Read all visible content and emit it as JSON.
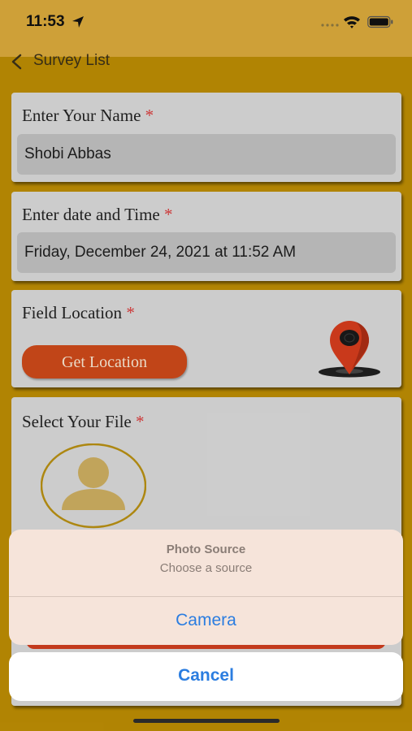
{
  "status_bar": {
    "time": "11:53"
  },
  "nav": {
    "back_label": "Survey List"
  },
  "form": {
    "name": {
      "label": "Enter Your Name",
      "required": "*",
      "value": "Shobi Abbas"
    },
    "datetime": {
      "label": "Enter date and Time",
      "required": "*",
      "value": "Friday, December 24, 2021 at 11:52 AM"
    },
    "location": {
      "label": "Field Location",
      "required": "*",
      "button_label": "Get Location"
    },
    "file": {
      "label": "Select Your File",
      "required": "*"
    }
  },
  "action_sheet": {
    "title": "Photo Source",
    "message": "Choose a source",
    "actions": [
      {
        "label": "Camera"
      }
    ],
    "cancel_label": "Cancel"
  },
  "colors": {
    "background": "#b98a04",
    "status_bar": "#d7a73b",
    "card": "#d5d5d5",
    "button": "#c9481a",
    "required": "#d53b3b",
    "action_text": "#2b7de0"
  },
  "icons": [
    "location-arrow-icon",
    "signal-dots-icon",
    "wifi-icon",
    "battery-icon",
    "back-chevron-icon",
    "map-pin-icon",
    "user-avatar-icon"
  ]
}
